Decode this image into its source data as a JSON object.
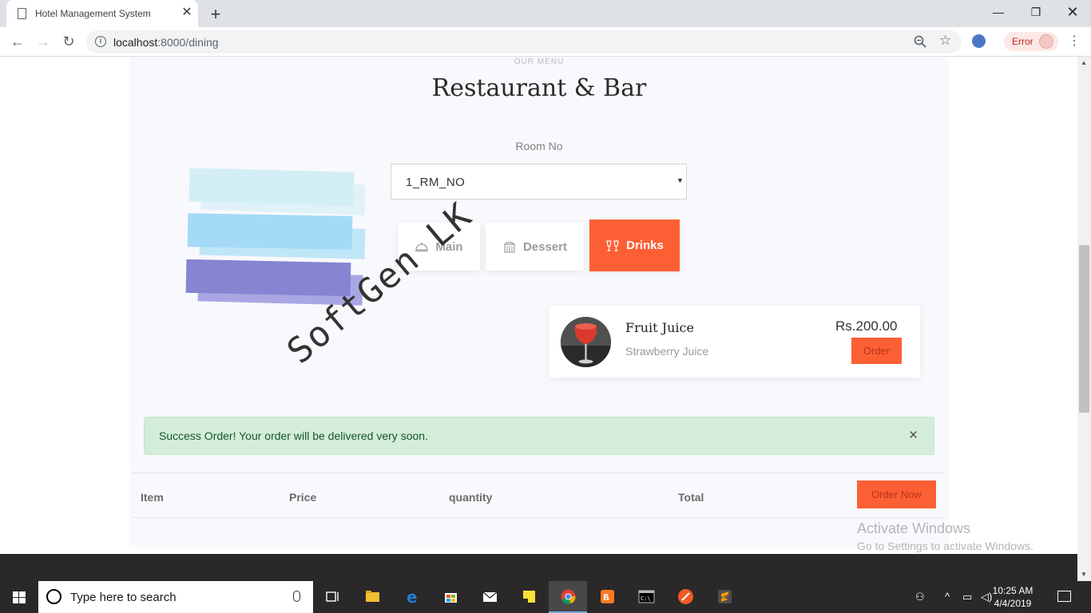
{
  "browser": {
    "tab_title": "Hotel Management System",
    "url_host": "localhost",
    "url_path": ":8000/dining",
    "error_label": "Error",
    "icons": [
      "page-icon",
      "close-icon",
      "plus-icon",
      "back-icon",
      "forward-icon",
      "reload-icon",
      "info-icon",
      "zoom-icon",
      "star-icon",
      "extension-icon",
      "profile-avatar",
      "menu-dots-icon"
    ]
  },
  "page": {
    "eyebrow": "OUR MENU",
    "heading": "Restaurant & Bar",
    "room": {
      "label": "Room No",
      "selected": "1_RM_NO"
    },
    "categories": [
      {
        "label": "Main",
        "icon": "cloche-icon",
        "active": false
      },
      {
        "label": "Dessert",
        "icon": "cake-icon",
        "active": false
      },
      {
        "label": "Drinks",
        "icon": "glasses-icon",
        "active": true
      }
    ],
    "menu_item": {
      "name": "Fruit Juice",
      "description": "Strawberry Juice",
      "price": "Rs.200.00",
      "order_label": "Order"
    },
    "alert": {
      "text": "Success Order! Your order will be delivered very soon.",
      "close": "×"
    },
    "cart": {
      "columns": [
        "Item",
        "Price",
        "quantity",
        "Total"
      ],
      "order_now_label": "Order Now"
    },
    "watermark": "SoftGen LK",
    "activate": {
      "title": "Activate Windows",
      "subtitle": "Go to Settings to activate Windows."
    },
    "colors": {
      "accent": "#fd5f34",
      "alert_bg": "#d4edda",
      "alert_text": "#155724"
    }
  },
  "taskbar": {
    "search_placeholder": "Type here to search",
    "time": "10:25 AM",
    "date": "4/4/2019",
    "apps": [
      "task-view-icon",
      "file-explorer-icon",
      "edge-icon",
      "store-icon",
      "mail-icon",
      "sticky-notes-icon",
      "chrome-icon",
      "xampp-icon",
      "terminal-icon",
      "postman-icon",
      "sublime-icon"
    ]
  }
}
